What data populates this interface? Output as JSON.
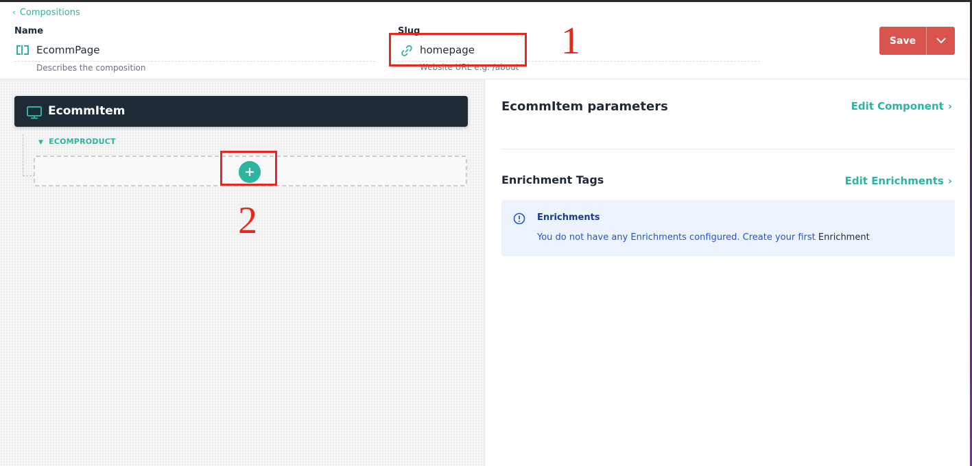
{
  "header": {
    "back_label": "Compositions",
    "name_label": "Name",
    "name_value": "EcommPage",
    "name_help": "Describes the composition",
    "slug_label": "Slug",
    "slug_value": "homepage",
    "slug_help": "Website URL e.g. /about",
    "save_label": "Save"
  },
  "annotations": {
    "one": "1",
    "two": "2"
  },
  "canvas": {
    "component_title": "EcommItem",
    "slot_label": "ECOMPRODUCT"
  },
  "panel": {
    "params_title": "EcommItem parameters",
    "edit_component_label": "Edit Component",
    "enrichment_title": "Enrichment Tags",
    "edit_enrichments_label": "Edit Enrichments",
    "alert": {
      "title": "Enrichments",
      "text": "You do not have any Enrichments configured. Create your first",
      "link_tail": "Enrichment"
    }
  },
  "colors": {
    "accent": "#2bb5a0",
    "save": "#d9534f",
    "dark_bar": "#1f2a37",
    "annotation": "#e5291e",
    "alert_bg": "#ecf3fd"
  }
}
